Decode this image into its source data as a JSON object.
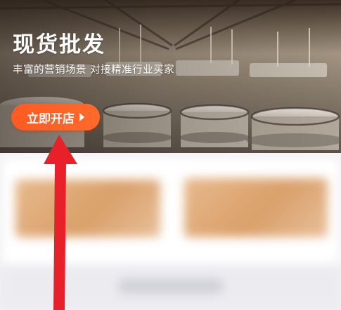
{
  "hero": {
    "title": "现货批发",
    "subtitle": "丰富的营销场景 对接精准行业买家",
    "cta_label": "立即开店",
    "cta_icon": "play-icon"
  },
  "colors": {
    "cta_background": "#ff5a22",
    "annotation_arrow": "#e8202a",
    "blurred_card": "#dba46f"
  }
}
